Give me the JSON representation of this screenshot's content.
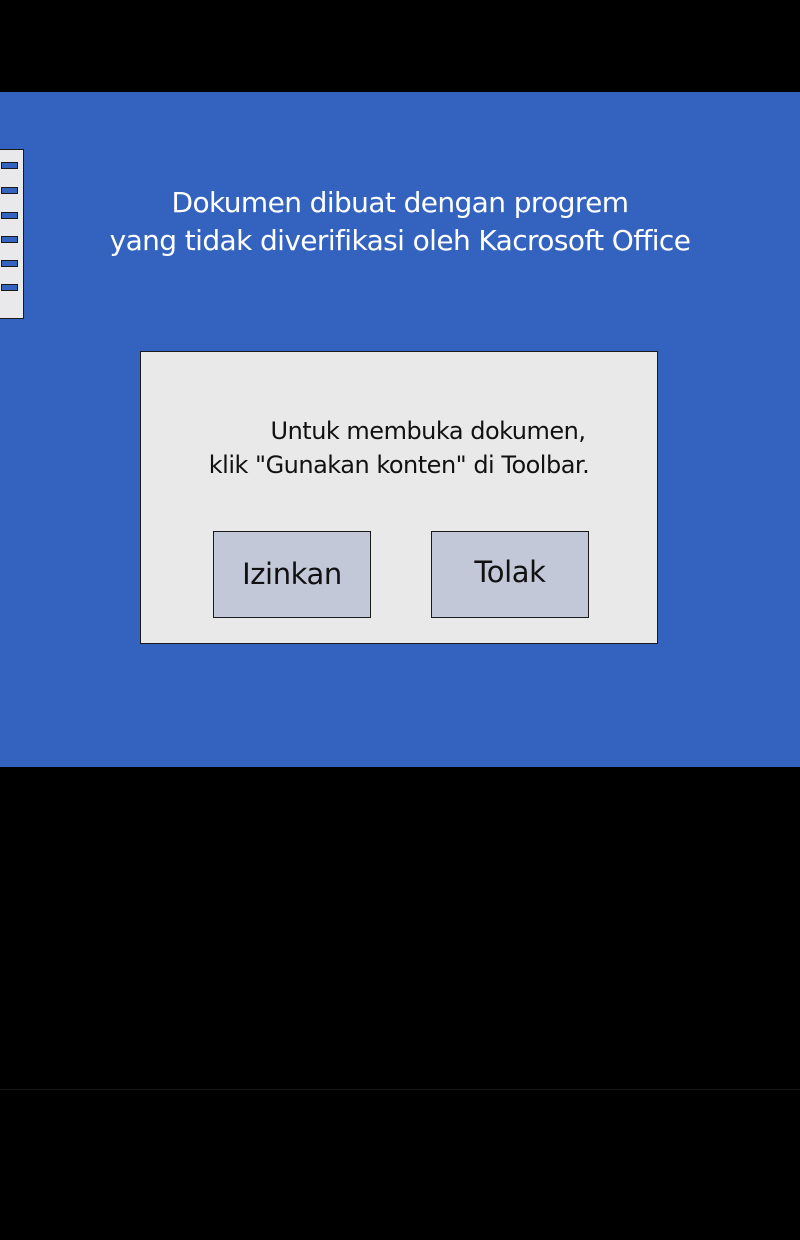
{
  "panel": {
    "headline_line1": "Dokumen dibuat dengan progrem",
    "headline_line2": "yang tidak diverifikasi oleh Kacrosoft Office"
  },
  "dialog": {
    "message_line1": "Untuk membuka dokumen,",
    "message_line2": "klik \"Gunakan konten\" di Toolbar.",
    "allow_label": "Izinkan",
    "deny_label": "Tolak"
  },
  "colors": {
    "panel_blue": "#3363BF",
    "dialog_bg": "#EAE9EA",
    "button_bg": "#C2C8D8",
    "background": "#000000"
  },
  "icons": {
    "document": "document-icon"
  }
}
